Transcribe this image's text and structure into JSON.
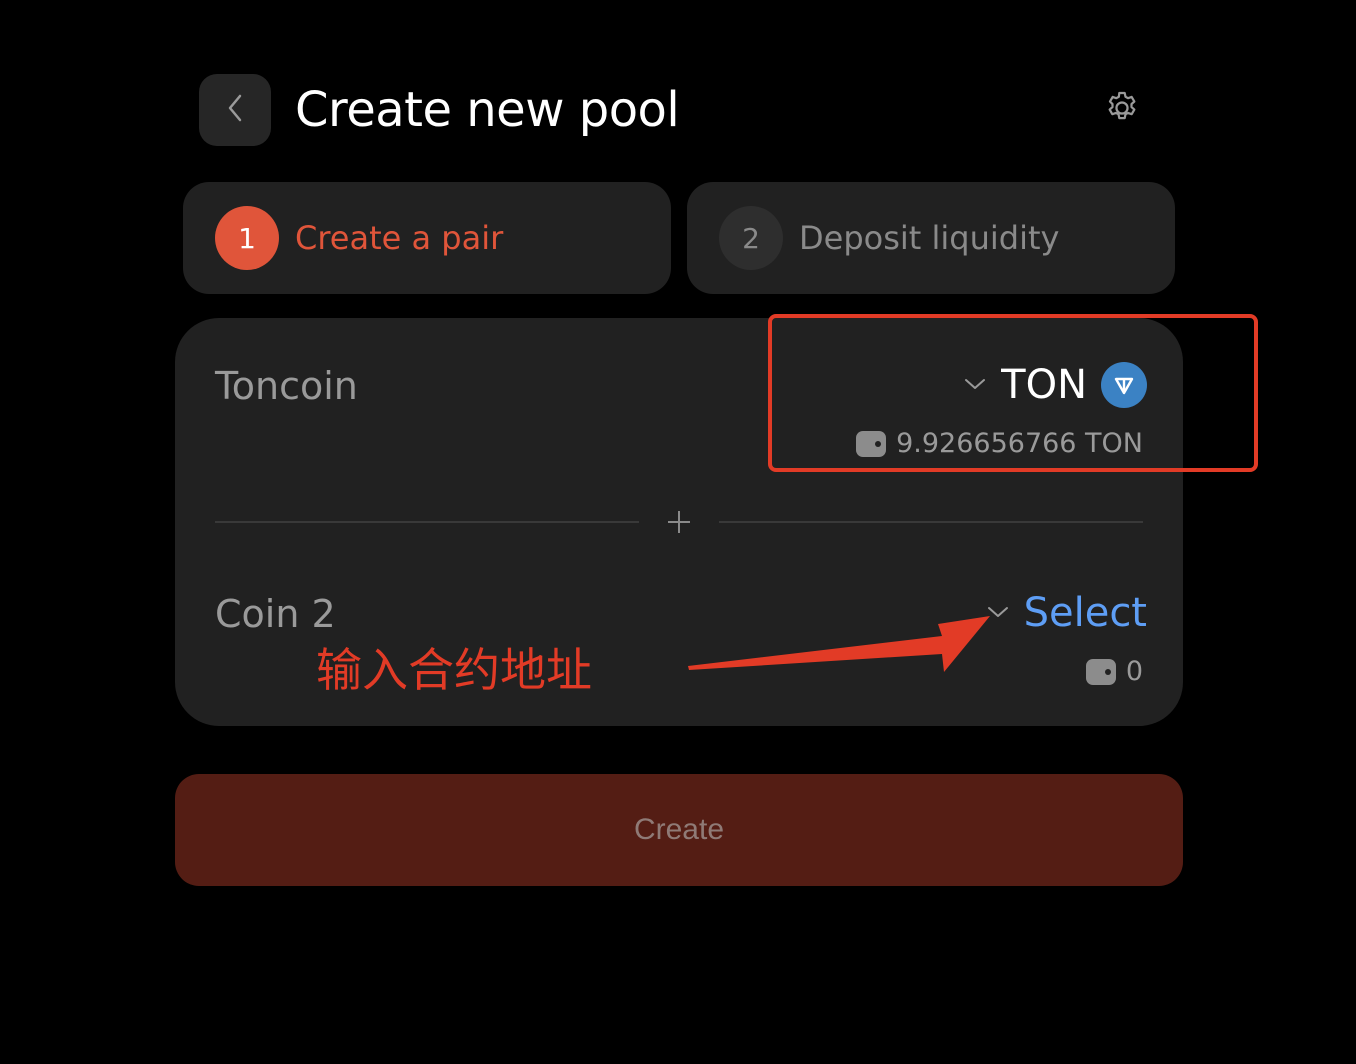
{
  "header": {
    "title": "Create new pool"
  },
  "steps": [
    {
      "number": "1",
      "label": "Create a pair",
      "active": true
    },
    {
      "number": "2",
      "label": "Deposit liquidity",
      "active": false
    }
  ],
  "coin1": {
    "name": "Toncoin",
    "symbol": "TON",
    "balance": "9.926656766 TON",
    "logo_color": "#3b82c4"
  },
  "coin2": {
    "name": "Coin 2",
    "select_label": "Select",
    "balance": "0"
  },
  "create_button": {
    "label": "Create"
  },
  "annotation": {
    "text": "输入合约地址",
    "color": "#e23b26"
  },
  "colors": {
    "accent": "#e0553a",
    "link": "#5e9ef5",
    "card": "#212121",
    "create_disabled": "#541d14"
  }
}
